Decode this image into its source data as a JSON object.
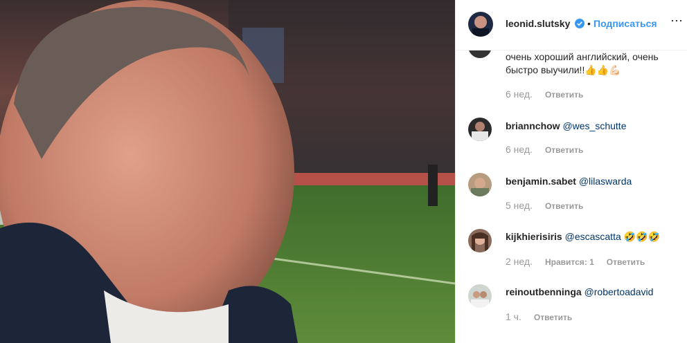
{
  "header": {
    "username": "leonid.slutsky",
    "verified_icon": "verified-badge-icon",
    "separator": "•",
    "follow_label": "Подписаться",
    "more_icon": "more-options-icon"
  },
  "comments": [
    {
      "username": "",
      "text": "очень хороший английский, очень быстро выучили!!",
      "emoji": "👍👍💪🏻",
      "time": "6 нед.",
      "reply": "Ответить"
    },
    {
      "username": "briannchow",
      "mention": "@wes_schutte",
      "text": "",
      "time": "6 нед.",
      "reply": "Ответить"
    },
    {
      "username": "benjamin.sabet",
      "mention": "@lilaswarda",
      "text": "",
      "time": "5 нед.",
      "reply": "Ответить"
    },
    {
      "username": "kijkhierisiris",
      "mention": "@escascatta",
      "text": "🤣🤣🤣",
      "time": "2 нед.",
      "likes": "Нравится: 1",
      "reply": "Ответить"
    },
    {
      "username": "reinoutbenninga",
      "mention": "@robertoadavid",
      "text": "",
      "time": "1 ч.",
      "reply": "Ответить"
    }
  ],
  "colors": {
    "accent": "#3897f0",
    "verified": "#3897f0",
    "mention": "#003569",
    "muted": "#999999"
  }
}
